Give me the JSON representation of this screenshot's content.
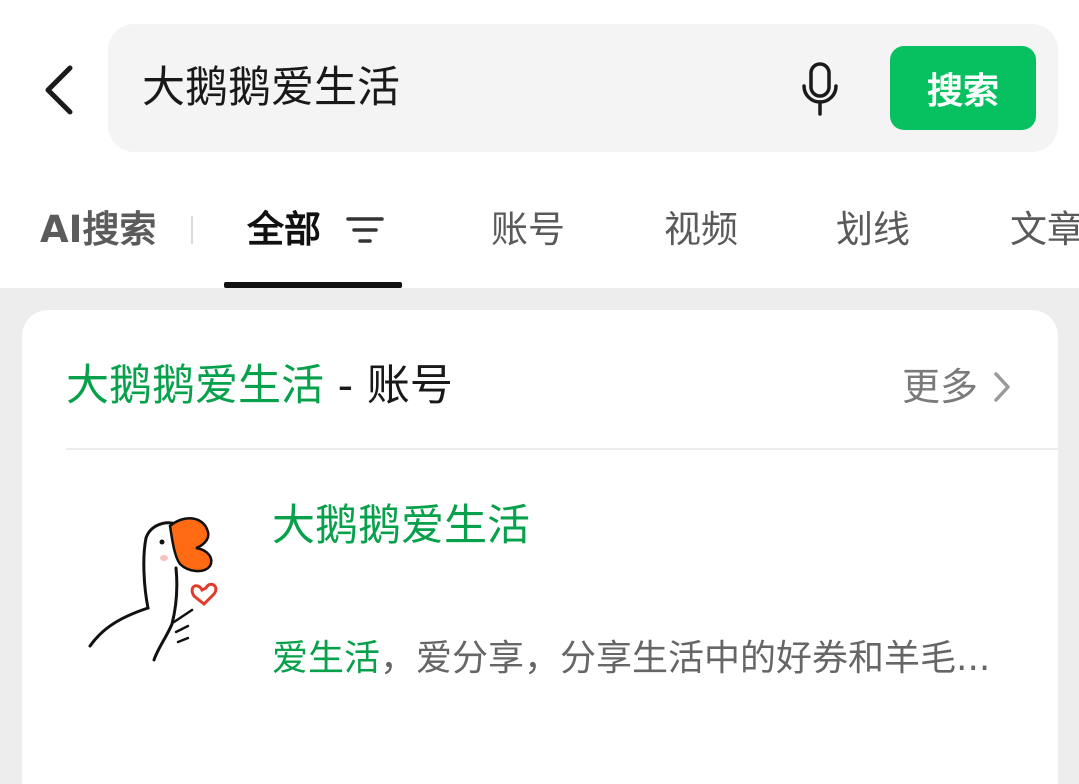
{
  "search": {
    "query": "大鹅鹅爱生活",
    "button_label": "搜索"
  },
  "tabs": [
    {
      "label": "AI搜索"
    },
    {
      "label": "全部"
    },
    {
      "label": "账号"
    },
    {
      "label": "视频"
    },
    {
      "label": "划线"
    },
    {
      "label": "文章"
    }
  ],
  "result_card": {
    "title_query": "大鹅鹅爱生活",
    "title_suffix": " - 账号",
    "more_label": "更多",
    "account": {
      "name": "大鹅鹅爱生活",
      "desc_highlight": "爱生活",
      "desc_rest": "，爱分享，分享生活中的好券和羊毛..."
    }
  },
  "colors": {
    "accent": "#07c160",
    "highlight_text": "#07a04b",
    "avatar_beak": "#ff6a13",
    "avatar_heart": "#e23b2e"
  }
}
